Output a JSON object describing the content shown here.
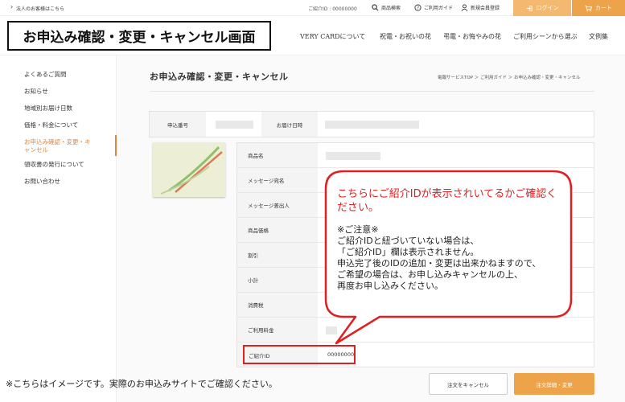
{
  "topbar": {
    "corporate_link": "法人のお客様はこちら",
    "referral_label": "ご紹介ID",
    "referral_value": "00000000",
    "search": "商品検索",
    "guide": "ご利用ガイド",
    "register": "新規会員登録",
    "login": "ログイン",
    "cart": "カート"
  },
  "header": {
    "headline": "お申込み確認・変更・キャンセル画面",
    "nav": [
      "VERY CARDについて",
      "祝電・お祝いの花",
      "弔電・お悔やみの花",
      "ご利用シーンから選ぶ",
      "文例集"
    ]
  },
  "sidebar": {
    "items": [
      "よくあるご質問",
      "お知らせ",
      "地域別お届け日数",
      "価格・料金について",
      "お申込み確認・変更・キャンセル",
      "領収書の発行について",
      "お問い合わせ"
    ],
    "active_index": 4
  },
  "main": {
    "title": "お申込み確認・変更・キャンセル",
    "breadcrumb": "電報サービスTOP ＞ ご利用ガイド ＞ お申込み確認・変更・キャンセル",
    "order_number_label": "申込番号",
    "delivery_date_label": "お届け日時",
    "rows": [
      "商品名",
      "メッセージ宛名",
      "メッセージ差出人",
      "商品価格",
      "割引",
      "小計",
      "消費税",
      "ご利用料金"
    ],
    "referral_label": "ご紹介ID",
    "referral_value": "00000000"
  },
  "callout": {
    "headline": "こちらにご紹介IDが表示されいてるかご確認ください。",
    "note_title": "※ご注意※",
    "note_lines": [
      "ご紹介IDと紐づいていない場合は、",
      "「ご紹介ID」欄は表示されません。",
      "申込完了後のIDの追加・変更は出来かねますので、",
      "ご希望の場合は、お申し込みキャンセルの上、",
      "再度お申し込みください。"
    ]
  },
  "footer": {
    "note": "※こちらはイメージです。実際のお申込みサイトでご確認ください。",
    "cancel_button": "注文をキャンセル",
    "detail_button": "注文詳細・変更"
  },
  "colors": {
    "accent": "#eca34a",
    "highlight": "#e02020"
  }
}
